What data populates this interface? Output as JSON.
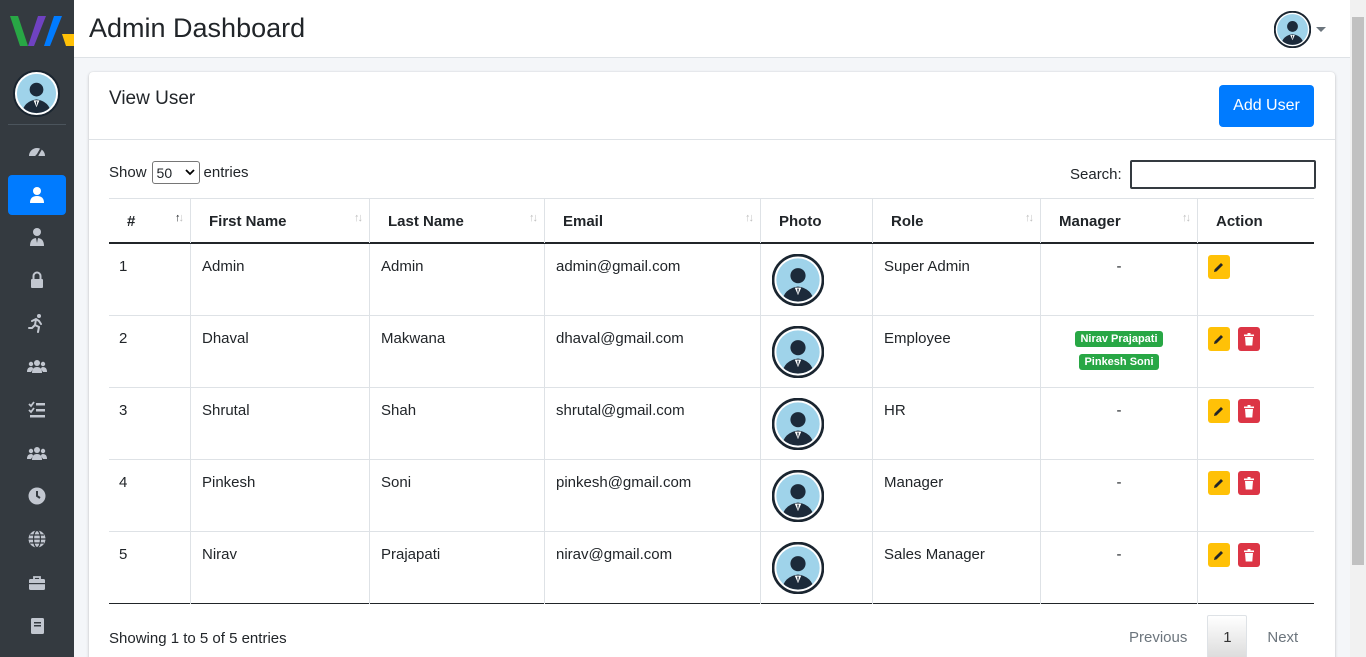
{
  "header": {
    "title": "Admin Dashboard"
  },
  "sidebar": {
    "items": [
      {
        "icon": "dashboard-gauge-icon",
        "active": false
      },
      {
        "icon": "user-icon",
        "active": true
      },
      {
        "icon": "user-tie-icon",
        "active": false
      },
      {
        "icon": "lock-icon",
        "active": false
      },
      {
        "icon": "running-person-icon",
        "active": false
      },
      {
        "icon": "users-group-icon",
        "active": false
      },
      {
        "icon": "task-list-icon",
        "active": false
      },
      {
        "icon": "team-icon",
        "active": false
      },
      {
        "icon": "clock-icon",
        "active": false
      },
      {
        "icon": "globe-icon",
        "active": false
      },
      {
        "icon": "briefcase-icon",
        "active": false
      },
      {
        "icon": "book-icon",
        "active": false
      }
    ]
  },
  "card": {
    "title": "View User",
    "add_label": "Add User",
    "show_label": "Show",
    "show_value": "50",
    "entries_label": "entries",
    "search_label": "Search:",
    "search_value": ""
  },
  "table": {
    "headers": [
      "#",
      "First Name",
      "Last Name",
      "Email",
      "Photo",
      "Role",
      "Manager",
      "Action"
    ],
    "rows": [
      {
        "num": "1",
        "first": "Admin",
        "last": "Admin",
        "email": "admin@gmail.com",
        "role": "Super Admin",
        "manager": "-",
        "managers": [],
        "deletable": false
      },
      {
        "num": "2",
        "first": "Dhaval",
        "last": "Makwana",
        "email": "dhaval@gmail.com",
        "role": "Employee",
        "manager": "",
        "managers": [
          "Nirav Prajapati",
          "Pinkesh Soni"
        ],
        "deletable": true
      },
      {
        "num": "3",
        "first": "Shrutal",
        "last": "Shah",
        "email": "shrutal@gmail.com",
        "role": "HR",
        "manager": "-",
        "managers": [],
        "deletable": true
      },
      {
        "num": "4",
        "first": "Pinkesh",
        "last": "Soni",
        "email": "pinkesh@gmail.com",
        "role": "Manager",
        "manager": "-",
        "managers": [],
        "deletable": true
      },
      {
        "num": "5",
        "first": "Nirav",
        "last": "Prajapati",
        "email": "nirav@gmail.com",
        "role": "Sales Manager",
        "manager": "-",
        "managers": [],
        "deletable": true
      }
    ]
  },
  "footer": {
    "info": "Showing 1 to 5 of 5 entries",
    "previous": "Previous",
    "page": "1",
    "next": "Next"
  },
  "colors": {
    "primary": "#007bff",
    "sidebar": "#343a40",
    "edit": "#ffc107",
    "delete": "#dc3545",
    "badge": "#28a745"
  }
}
